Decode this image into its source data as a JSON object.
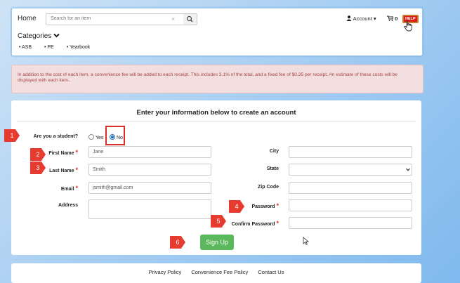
{
  "header": {
    "home_label": "Home",
    "search_placeholder": "Search for an item",
    "clear_glyph": "×",
    "search_icon": "search-icon",
    "account_label": "Account ▾",
    "cart_count": "0",
    "help_label": "HELP"
  },
  "categories": {
    "title": "Categories",
    "items": [
      "ASB",
      "PE",
      "Yearbook"
    ]
  },
  "alert": {
    "text": "In addition to the cost of each item, a convenience fee will be added to each receipt. This includes 3.1% of the total, and a fixed fee of $0.35 per receipt. An estimate of these costs will be displayed with each item.."
  },
  "form": {
    "title": "Enter your information below to create an account",
    "student_label": "Are you a student?",
    "opt_yes": "Yes",
    "opt_no": "No",
    "first_name_label": "First Name",
    "first_name_value": "Jane",
    "last_name_label": "Last Name",
    "last_name_value": "Smith",
    "email_label": "Email",
    "email_value": "jsmith@gmail.com",
    "address_label": "Address",
    "city_label": "City",
    "state_label": "State",
    "zip_label": "Zip Code",
    "password_label": "Password",
    "confirm_label": "Confirm Password",
    "required_mark": "*",
    "submit_label": "Sign Up"
  },
  "annotations": [
    "1",
    "2",
    "3",
    "4",
    "5",
    "6"
  ],
  "footer": {
    "links": [
      "Privacy Policy",
      "Convenience Fee Policy",
      "Contact Us"
    ]
  },
  "colors": {
    "accent": "#d9302c",
    "signup": "#5cb85c",
    "alert_bg": "#f2dede"
  }
}
